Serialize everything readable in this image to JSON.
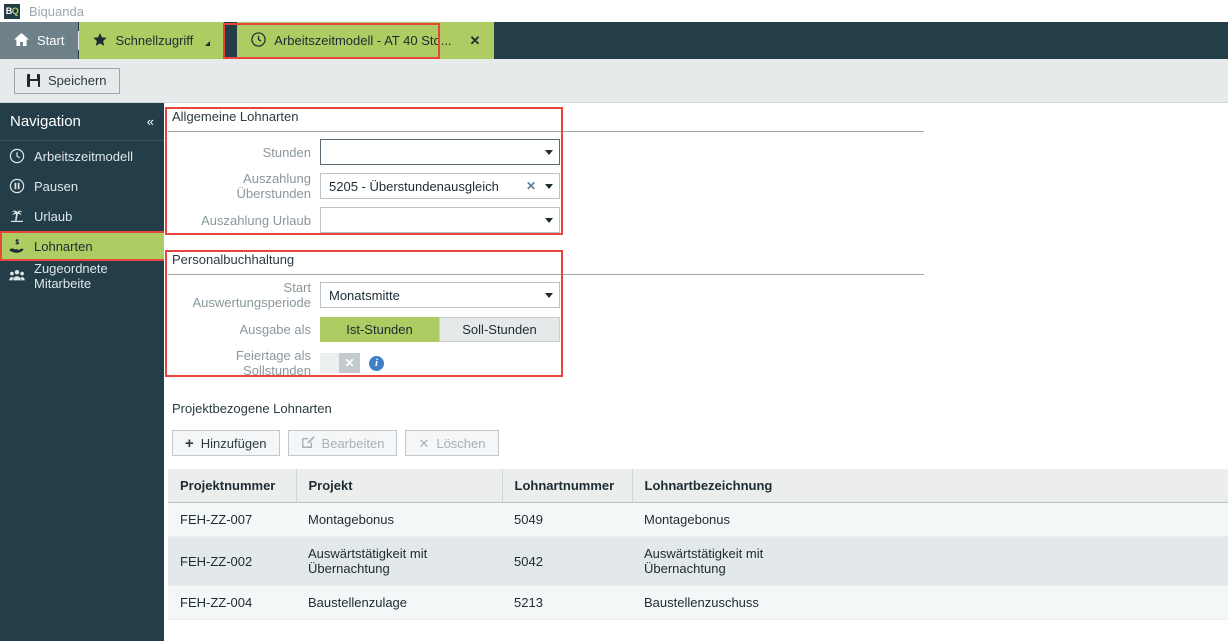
{
  "window": {
    "logo_b": "B",
    "logo_q": "Q",
    "app_title": "Biquanda"
  },
  "tabs": [
    {
      "label": "Start",
      "icon": "home-icon",
      "state": "inactive"
    },
    {
      "label": "Schnellzugriff",
      "icon": "star-icon",
      "state": "inactive"
    },
    {
      "label": "Arbeitszeitmodell - AT 40 Std...",
      "icon": "clock-icon",
      "state": "active",
      "close": "✕"
    }
  ],
  "toolbar": {
    "save_label": "Speichern",
    "save_icon": "save-floppy-icon"
  },
  "sidebar": {
    "title": "Navigation",
    "collapse_icon": "«",
    "items": [
      {
        "label": "Arbeitszeitmodell",
        "icon": "clock-icon",
        "active": false
      },
      {
        "label": "Pausen",
        "icon": "pause-circle-icon",
        "active": false
      },
      {
        "label": "Urlaub",
        "icon": "palm-tree-icon",
        "active": false
      },
      {
        "label": "Lohnarten",
        "icon": "hand-money-icon",
        "active": true
      },
      {
        "label": "Zugeordnete Mitarbeite",
        "icon": "people-group-icon",
        "active": false
      }
    ]
  },
  "general_section": {
    "title": "Allgemeine Lohnarten",
    "fields": [
      {
        "label": "Stunden",
        "value": "",
        "placeholder": "",
        "clearable": false
      },
      {
        "label": "Auszahlung Überstunden",
        "value": "5205 - Überstundenausgleich",
        "placeholder": "",
        "clearable": true,
        "clear_icon": "✕"
      },
      {
        "label": "Auszahlung Urlaub",
        "value": "",
        "placeholder": "",
        "clearable": false
      }
    ]
  },
  "payroll_section": {
    "title": "Personalbuchhaltung",
    "period_label": "Start Auswertungsperiode",
    "period_value": "Monatsmitte",
    "output_label": "Ausgabe als",
    "output_options": [
      {
        "label": "Ist-Stunden",
        "selected": true
      },
      {
        "label": "Soll-Stunden",
        "selected": false
      }
    ],
    "holiday_label": "Feiertage als Sollstunden",
    "holiday_state": "off",
    "holiday_mark": "✕",
    "info_icon": "info-icon",
    "info_glyph": "i"
  },
  "projects_section": {
    "title": "Projektbezogene Lohnarten",
    "buttons": [
      {
        "label": "Hinzufügen",
        "icon": "+",
        "icon_name": "plus-icon",
        "disabled": false
      },
      {
        "label": "Bearbeiten",
        "icon": "✎",
        "icon_name": "edit-pencil-icon",
        "disabled": true
      },
      {
        "label": "Löschen",
        "icon": "✕",
        "icon_name": "delete-x-icon",
        "disabled": true
      }
    ],
    "columns": [
      "Projektnummer",
      "Projekt",
      "Lohnartnummer",
      "Lohnartbezeichnung"
    ],
    "rows": [
      {
        "projektnummer": "FEH-ZZ-007",
        "projekt": "Montagebonus",
        "lohnartnummer": "5049",
        "lohnartbezeichnung": "Montagebonus"
      },
      {
        "projektnummer": "FEH-ZZ-002",
        "projekt": "Auswärtstätigkeit mit Übernachtung",
        "lohnartnummer": "5042",
        "lohnartbezeichnung": "Auswärtstätigkeit mit Übernachtung"
      },
      {
        "projektnummer": "FEH-ZZ-004",
        "projekt": "Baustellenzulage",
        "lohnartnummer": "5213",
        "lohnartbezeichnung": "Baustellenzuschuss"
      }
    ]
  },
  "colors": {
    "accent_green": "#afcc63",
    "dark_navy": "#233e48",
    "annotation_red": "#e8453c",
    "info_blue": "#3f80c4"
  }
}
